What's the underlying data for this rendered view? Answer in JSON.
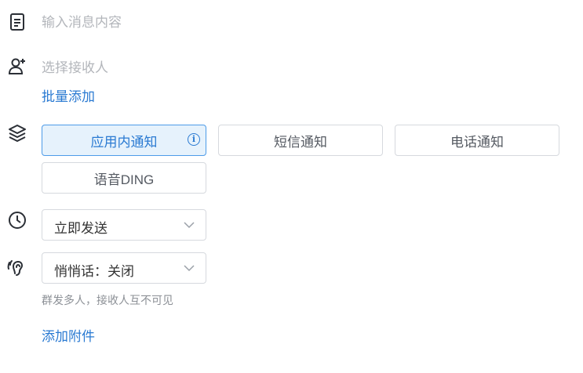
{
  "message": {
    "placeholder": "输入消息内容",
    "icon": "document-icon"
  },
  "receiver": {
    "placeholder": "选择接收人",
    "icon": "add-user-icon",
    "batch_add": "批量添加"
  },
  "notify_types": {
    "icon": "layers-icon",
    "options": [
      {
        "label": "应用内通知",
        "selected": true,
        "info_icon": "info-icon"
      },
      {
        "label": "短信通知",
        "selected": false
      },
      {
        "label": "电话通知",
        "selected": false
      },
      {
        "label": "语音DING",
        "selected": false
      }
    ]
  },
  "send_time": {
    "icon": "clock-icon",
    "value": "立即发送"
  },
  "whisper": {
    "icon": "ear-icon",
    "value": "悄悄话：关闭",
    "hint": "群发多人，接收人互不可见"
  },
  "attachment": {
    "label": "添加附件"
  },
  "colors": {
    "accent": "#2a7ad2",
    "selected_bg": "#e6f2fc",
    "border": "#d6d9de"
  }
}
